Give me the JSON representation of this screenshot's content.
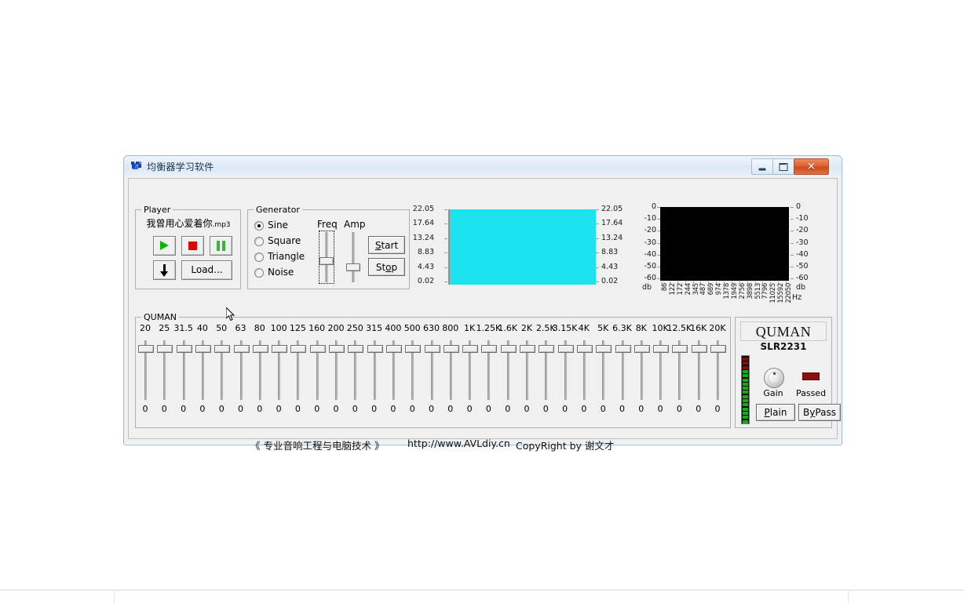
{
  "window": {
    "title": "均衡器学习软件",
    "icon": "app-icon",
    "buttons": {
      "minimize": "minimize",
      "maximize": "maximize",
      "close": "✕"
    }
  },
  "player": {
    "legend": "Player",
    "file_name": "我曾用心爱着你",
    "file_ext": ".mp3",
    "play": "play-icon",
    "stop": "stop-icon",
    "pause": "pause-icon",
    "download": "down-arrow-icon",
    "load_label": "Load..."
  },
  "generator": {
    "legend": "Generator",
    "waveforms": [
      {
        "label": "Sine",
        "selected": true
      },
      {
        "label": "Square",
        "selected": false
      },
      {
        "label": "Triangle",
        "selected": false
      },
      {
        "label": "Noise",
        "selected": false
      }
    ],
    "freq_label": "Freq",
    "amp_label": "Amp",
    "freq_value_pct": 58,
    "amp_value_pct": 72,
    "start_label": "Start",
    "start_mnemonic": "S",
    "stop_label": "Stop",
    "stop_mnemonic": "o"
  },
  "scope": {
    "screen_color": "#1be3f0",
    "left_ticks": [
      "22.05",
      "17.64",
      "13.24",
      "8.83",
      "4.43",
      "0.02"
    ],
    "right_ticks": [
      "22.05",
      "17.64",
      "13.24",
      "8.83",
      "4.43",
      "0.02"
    ]
  },
  "spectrum": {
    "screen_color": "#000000",
    "left_ticks": [
      "0",
      "-10",
      "-20",
      "-30",
      "-40",
      "-50",
      "-60"
    ],
    "right_ticks": [
      "0",
      "-10",
      "-20",
      "-30",
      "-40",
      "-50",
      "-60"
    ],
    "unit_left": "db",
    "unit_right": "db",
    "freq_unit": "Hz",
    "freq_ticks": [
      "86",
      "122",
      "172",
      "244",
      "345",
      "487",
      "689",
      "974",
      "1378",
      "1949",
      "2756",
      "3898",
      "5513",
      "7796",
      "11025",
      "15592",
      "22050"
    ]
  },
  "equalizer": {
    "legend": "QUMAN",
    "bands": [
      {
        "label": "20",
        "value": "0"
      },
      {
        "label": "25",
        "value": "0"
      },
      {
        "label": "31.5",
        "value": "0"
      },
      {
        "label": "40",
        "value": "0"
      },
      {
        "label": "50",
        "value": "0"
      },
      {
        "label": "63",
        "value": "0"
      },
      {
        "label": "80",
        "value": "0"
      },
      {
        "label": "100",
        "value": "0"
      },
      {
        "label": "125",
        "value": "0"
      },
      {
        "label": "160",
        "value": "0"
      },
      {
        "label": "200",
        "value": "0"
      },
      {
        "label": "250",
        "value": "0"
      },
      {
        "label": "315",
        "value": "0"
      },
      {
        "label": "400",
        "value": "0"
      },
      {
        "label": "500",
        "value": "0"
      },
      {
        "label": "630",
        "value": "0"
      },
      {
        "label": "800",
        "value": "0"
      },
      {
        "label": "1K",
        "value": "0"
      },
      {
        "label": "1.25K",
        "value": "0"
      },
      {
        "label": "1.6K",
        "value": "0"
      },
      {
        "label": "2K",
        "value": "0"
      },
      {
        "label": "2.5K",
        "value": "0"
      },
      {
        "label": "3.15K",
        "value": "0"
      },
      {
        "label": "4K",
        "value": "0"
      },
      {
        "label": "5K",
        "value": "0"
      },
      {
        "label": "6.3K",
        "value": "0"
      },
      {
        "label": "8K",
        "value": "0"
      },
      {
        "label": "10K",
        "value": "0"
      },
      {
        "label": "12.5K",
        "value": "0"
      },
      {
        "label": "16K",
        "value": "0"
      },
      {
        "label": "20K",
        "value": "0"
      }
    ]
  },
  "device_panel": {
    "brand": "QUMAN",
    "model": "SLR2231",
    "gain_label": "Gain",
    "passed_label": "Passed",
    "passed_led_color": "#8b0f0f",
    "plain_label": "Plain",
    "plain_mnemonic": "P",
    "bypass_label": "ByPass",
    "bypass_mnemonic": "y",
    "meter_levels": [
      "#7a1010",
      "#7a1010",
      "#7a1010",
      "#1aa81a",
      "#1aa81a",
      "#1aa81a",
      "#1aa81a",
      "#1aa81a",
      "#1aa81a",
      "#1aa81a",
      "#1aa81a",
      "#1aa81a",
      "#1aa81a",
      "#1aa81a",
      "#1aa81a",
      "#1aa81a"
    ]
  },
  "footer": {
    "slogan": "《 专业音响工程与电脑技术 》",
    "url": "http://www.AVLdiy.cn",
    "copyright": "CopyRight by  谢文才"
  }
}
